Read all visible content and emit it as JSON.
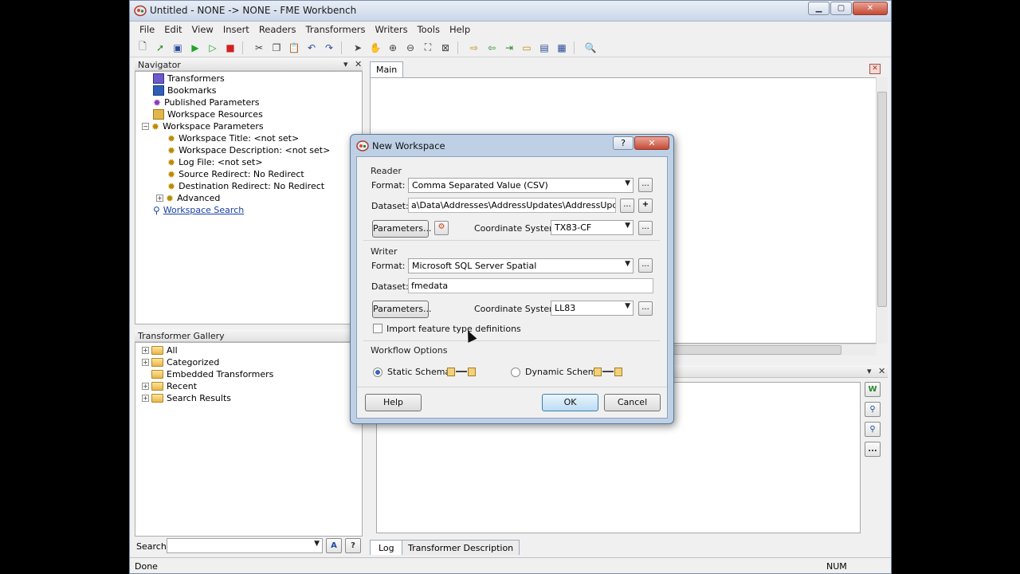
{
  "window": {
    "title": "Untitled - NONE -> NONE - FME Workbench",
    "minimize": "▁",
    "maximize": "▢",
    "close": "✕"
  },
  "menu": [
    "File",
    "Edit",
    "View",
    "Insert",
    "Readers",
    "Transformers",
    "Writers",
    "Tools",
    "Help"
  ],
  "navigator": {
    "header": "Navigator",
    "pin": "▾",
    "close": "✕",
    "items": {
      "transformers": "Transformers",
      "bookmarks": "Bookmarks",
      "published_parameters": "Published Parameters",
      "workspace_resources": "Workspace Resources",
      "workspace_parameters": "Workspace Parameters",
      "workspace_title": "Workspace Title: <not set>",
      "workspace_description": "Workspace Description: <not set>",
      "log_file": "Log File: <not set>",
      "source_redirect": "Source Redirect: No Redirect",
      "destination_redirect": "Destination Redirect: No Redirect",
      "advanced": "Advanced",
      "workspace_search": "Workspace Search"
    }
  },
  "transformer_gallery": {
    "header": "Transformer Gallery",
    "items": [
      "All",
      "Categorized",
      "Embedded Transformers",
      "Recent",
      "Search Results"
    ],
    "search_label": "Search:",
    "search_value": ""
  },
  "main_tab": "Main",
  "bottom_tabs": {
    "log": "Log",
    "transformer_description": "Transformer Description"
  },
  "status": {
    "left": "Done",
    "num": "NUM"
  },
  "dialog": {
    "title": "New Workspace",
    "help_q": "?",
    "close": "✕",
    "reader": {
      "group": "Reader",
      "format_label": "Format:",
      "format_value": "Comma Separated Value (CSV)",
      "dataset_label": "Dataset:",
      "dataset_value": "a\\Data\\Addresses\\AddressUpdates\\AddressUpdates.csv",
      "parameters_button": "Parameters...",
      "coord_label": "Coordinate System:",
      "coord_value": "TX83-CF"
    },
    "writer": {
      "group": "Writer",
      "format_label": "Format:",
      "format_value": "Microsoft SQL Server Spatial",
      "dataset_label": "Dataset:",
      "dataset_value": "fmedata",
      "parameters_button": "Parameters...",
      "coord_label": "Coordinate System:",
      "coord_value": "LL83"
    },
    "import_feature_types": "Import feature type definitions",
    "workflow": {
      "group": "Workflow Options",
      "static": "Static Schema",
      "dynamic": "Dynamic Schema",
      "selected": "static"
    },
    "buttons": {
      "help": "Help",
      "ok": "OK",
      "cancel": "Cancel"
    },
    "dots": "..."
  }
}
